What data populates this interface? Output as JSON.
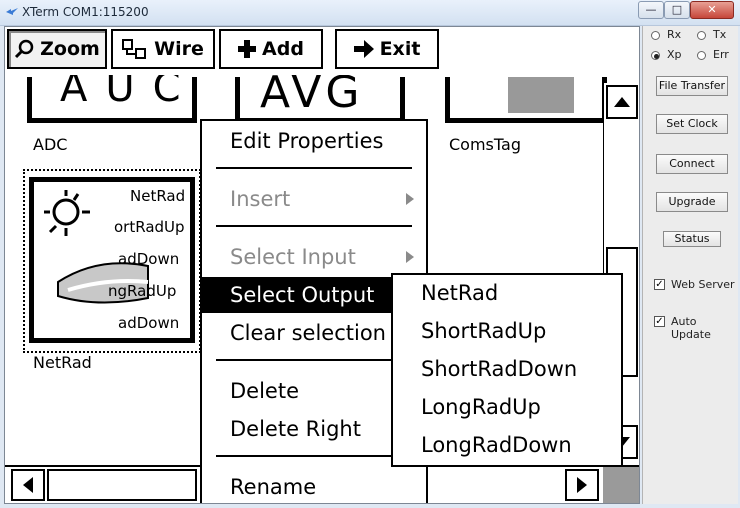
{
  "window": {
    "title": "XTerm COM1:115200",
    "minimize": "—",
    "maximize": "□",
    "close": "✕"
  },
  "toolbar": {
    "zoom": "Zoom",
    "wire": "Wire",
    "add": "Add",
    "exit": "Exit"
  },
  "blocks": {
    "adc_label": "ADC",
    "adc_display": "AUC",
    "avg_display": "AVG",
    "comstag_label": "ComsTag",
    "netrad_label": "NetRad",
    "netrad_outputs": [
      "NetRad",
      "ortRadUp",
      "adDown",
      "ngRadUp",
      "adDown"
    ]
  },
  "context_menu": {
    "items": [
      "Edit Properties",
      "Insert",
      "Select Input",
      "Select Output",
      "Clear selection",
      "Delete",
      "Delete Right",
      "Rename"
    ]
  },
  "submenu": {
    "items": [
      "NetRad",
      "ShortRadUp",
      "ShortRadDown",
      "LongRadUp",
      "LongRadDown"
    ]
  },
  "side_panel": {
    "radios": [
      "Rx",
      "Tx",
      "Xp",
      "Err"
    ],
    "selected_radio": "Xp",
    "buttons": [
      "File Transfer",
      "Set Clock",
      "Connect",
      "Upgrade",
      "Status"
    ],
    "checks": [
      "Web Server",
      "Auto Update"
    ],
    "check_mark": "✓"
  }
}
